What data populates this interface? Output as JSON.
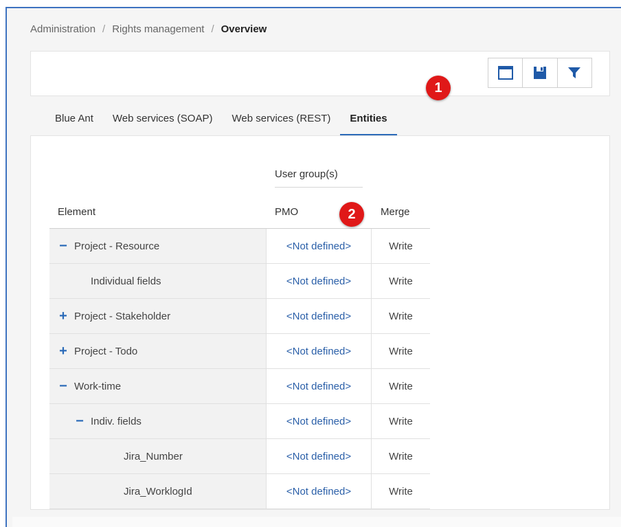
{
  "breadcrumb": {
    "items": [
      "Administration",
      "Rights management"
    ],
    "current": "Overview",
    "separator": "/"
  },
  "toolbar": {
    "buttons": [
      {
        "name": "window-icon"
      },
      {
        "name": "save-icon"
      },
      {
        "name": "filter-icon"
      }
    ],
    "accent": "#1f5aa8"
  },
  "tabs": [
    {
      "label": "Blue Ant",
      "active": false
    },
    {
      "label": "Web services (SOAP)",
      "active": false
    },
    {
      "label": "Web services (REST)",
      "active": false
    },
    {
      "label": "Entities",
      "active": true
    }
  ],
  "badges": [
    "1",
    "2"
  ],
  "table": {
    "group_header": "User group(s)",
    "columns": [
      "Element",
      "PMO",
      "Merge"
    ],
    "rows": [
      {
        "expand": "−",
        "element": "Project - Resource",
        "indent": 0,
        "pmo": "<Not defined>",
        "merge": "Write"
      },
      {
        "expand": "",
        "element": "Individual fields",
        "indent": 1,
        "pmo": "<Not defined>",
        "merge": "Write"
      },
      {
        "expand": "+",
        "element": "Project - Stakeholder",
        "indent": 0,
        "pmo": "<Not defined>",
        "merge": "Write"
      },
      {
        "expand": "+",
        "element": "Project - Todo",
        "indent": 0,
        "pmo": "<Not defined>",
        "merge": "Write"
      },
      {
        "expand": "−",
        "element": "Work-time",
        "indent": 0,
        "pmo": "<Not defined>",
        "merge": "Write"
      },
      {
        "expand": "−",
        "element": "Indiv. fields",
        "indent": 1,
        "pmo": "<Not defined>",
        "merge": "Write"
      },
      {
        "expand": "",
        "element": "Jira_Number",
        "indent": 2,
        "pmo": "<Not defined>",
        "merge": "Write"
      },
      {
        "expand": "",
        "element": "Jira_WorklogId",
        "indent": 2,
        "pmo": "<Not defined>",
        "merge": "Write"
      }
    ]
  },
  "colors": {
    "frame_border": "#3d72c0",
    "link": "#2a5fa8",
    "tab_active": "#2a6ab8",
    "badge": "#e01818"
  }
}
